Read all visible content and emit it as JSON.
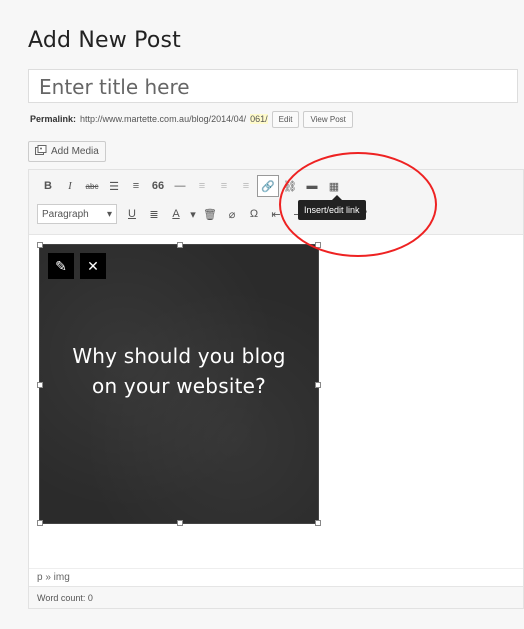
{
  "page": {
    "title": "Add New Post"
  },
  "title_field": {
    "placeholder": "Enter title here"
  },
  "permalink": {
    "label": "Permalink:",
    "url": "http://www.martette.com.au/blog/2014/04/",
    "slug": "061/",
    "edit_label": "Edit",
    "view_label": "View Post"
  },
  "add_media": {
    "label": "Add Media",
    "icon": "media-icon"
  },
  "toolbar": {
    "row1": [
      {
        "label": "B",
        "icon": "bold-icon"
      },
      {
        "label": "I",
        "icon": "italic-icon"
      },
      {
        "label": "abc",
        "icon": "strikethrough-icon"
      },
      {
        "label": "☰",
        "icon": "bullet-list-icon"
      },
      {
        "label": "≡",
        "icon": "numbered-list-icon"
      },
      {
        "label": "66",
        "icon": "blockquote-icon"
      },
      {
        "label": "—",
        "icon": "horizontal-rule-icon"
      },
      {
        "label": "≡",
        "icon": "align-left-icon"
      },
      {
        "label": "≡",
        "icon": "align-center-icon"
      },
      {
        "label": "≡",
        "icon": "align-right-icon"
      },
      {
        "label": "🔗",
        "icon": "link-icon"
      },
      {
        "label": "⛓",
        "icon": "unlink-icon"
      },
      {
        "label": "▬",
        "icon": "read-more-icon"
      },
      {
        "label": "▦",
        "icon": "toolbar-toggle-icon"
      }
    ],
    "format_select": "Paragraph",
    "row2": [
      {
        "label": "U",
        "icon": "underline-icon"
      },
      {
        "label": "≣",
        "icon": "justify-icon"
      },
      {
        "label": "A",
        "icon": "text-color-icon"
      },
      {
        "label": "▾",
        "icon": "text-color-dropdown-icon"
      },
      {
        "label": "🗑",
        "icon": "paste-text-icon"
      },
      {
        "label": "⌀",
        "icon": "clear-formatting-icon"
      },
      {
        "label": "Ω",
        "icon": "special-character-icon"
      },
      {
        "label": "⇤",
        "icon": "outdent-icon"
      },
      {
        "label": "⇥",
        "icon": "indent-icon"
      },
      {
        "label": "↶",
        "icon": "undo-icon"
      },
      {
        "label": "↷",
        "icon": "redo-icon"
      },
      {
        "label": "?",
        "icon": "help-icon"
      }
    ],
    "tooltip": "Insert/edit link"
  },
  "content": {
    "image_text_line1": "Why should you blog",
    "image_text_line2": "on your website?",
    "edit_icon": "pencil-icon",
    "remove_icon": "close-icon"
  },
  "status": {
    "path": "p » img",
    "word_count": "Word count: 0"
  },
  "colors": {
    "highlight": "#e22222",
    "image_bg": "#2b2b2b",
    "tooltip_bg": "#222222"
  }
}
